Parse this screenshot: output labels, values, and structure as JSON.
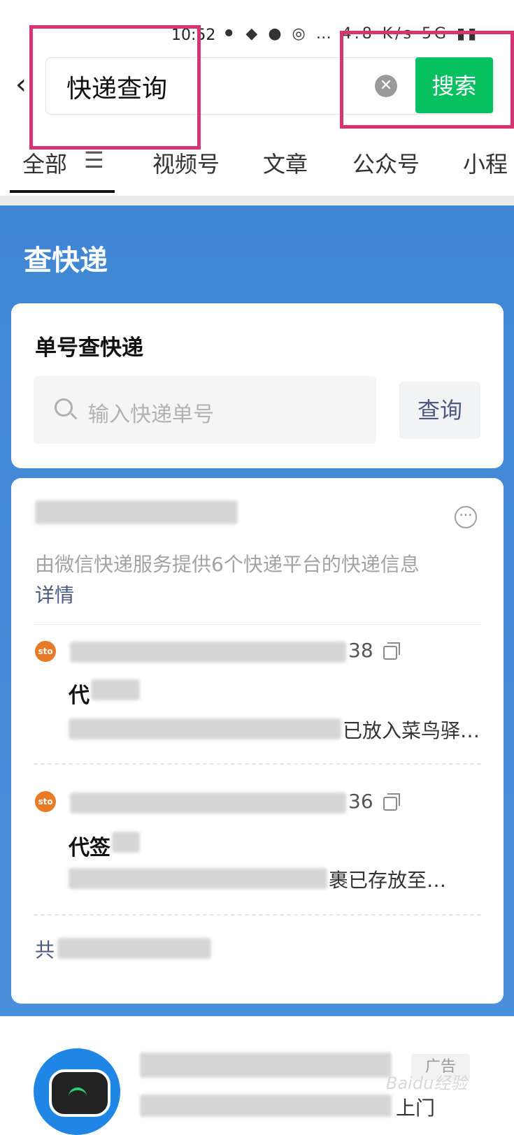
{
  "status_bar": {
    "time": "10:52",
    "icons": "⚫ ◆ ● ◎ … 4.8 K/s 5G ▮▮"
  },
  "header": {
    "search_value": "快递查询",
    "clear_glyph": "✕",
    "search_button": "搜索"
  },
  "tabs": [
    {
      "label": "全部",
      "active": true
    },
    {
      "label": "视频号"
    },
    {
      "label": "文章"
    },
    {
      "label": "公众号"
    },
    {
      "label": "小程"
    }
  ],
  "express": {
    "title": "查快递",
    "single_query": {
      "title": "单号查快递",
      "placeholder": "输入快递单号",
      "button": "查询"
    },
    "packages": {
      "provider_note": "由微信快递服务提供6个快递平台的快递信息",
      "details_link": "详情",
      "items": [
        {
          "carrier_icon": "sto",
          "number_tail": "38",
          "status": "代",
          "text_tail": "已放入菜鸟驿…"
        },
        {
          "carrier_icon": "sto",
          "number_tail": "36",
          "status": "代签",
          "text_tail": "裹已存放至…"
        }
      ],
      "footer_prefix": "共"
    }
  },
  "ad": {
    "badge": "广告",
    "text_tail": "上门",
    "watermark": "Baidu经验"
  },
  "colors": {
    "accent_green": "#07c160",
    "blue_bg": "#3f86d4",
    "highlight": "#d73572",
    "sto_orange": "#e87a28"
  }
}
